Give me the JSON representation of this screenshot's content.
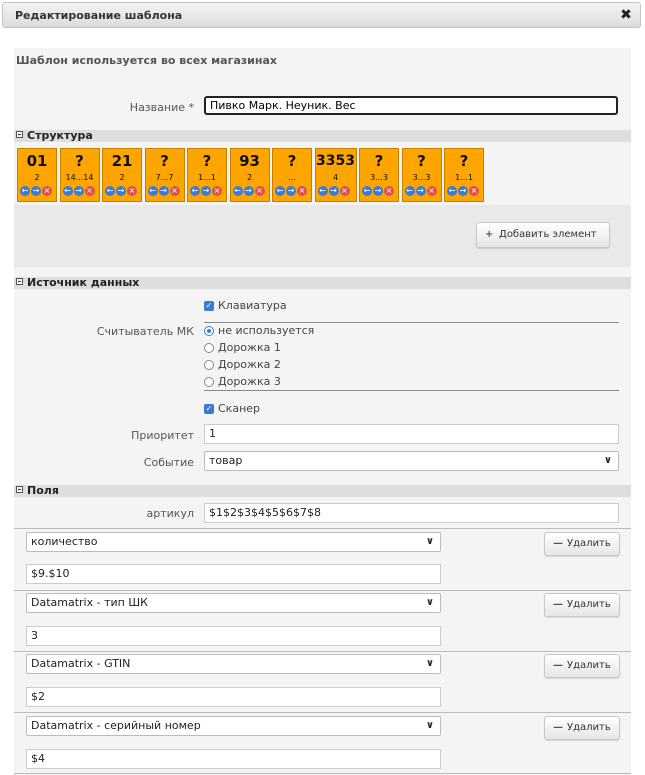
{
  "window": {
    "title": "Редактирование шаблона",
    "close_label": "✖"
  },
  "info_text": "Шаблон используется во всех магазинах",
  "name": {
    "label": "Название *",
    "value": "Пивко Марк. Неуник. Вес"
  },
  "structure": {
    "header": "Структура",
    "blocks": [
      {
        "big": "01",
        "small": "2"
      },
      {
        "big": "?",
        "small": "14...14"
      },
      {
        "big": "21",
        "small": "2"
      },
      {
        "big": "?",
        "small": "7...7"
      },
      {
        "big": "?",
        "small": "1...1"
      },
      {
        "big": "93",
        "small": "2"
      },
      {
        "big": "?",
        "small": "..."
      },
      {
        "big": "3353",
        "small": "4"
      },
      {
        "big": "?",
        "small": "3...3"
      },
      {
        "big": "?",
        "small": "3...3"
      },
      {
        "big": "?",
        "small": "1...1"
      }
    ],
    "add_button": "Добавить элемент"
  },
  "data_source": {
    "header": "Источник данных",
    "keyboard_label": "Клавиатура",
    "reader_label": "Считыватель МК",
    "reader_options": [
      "не используется",
      "Дорожка 1",
      "Дорожка 2",
      "Дорожка 3"
    ],
    "scanner_label": "Сканер",
    "priority_label": "Приоритет",
    "priority_value": "1",
    "event_label": "Событие",
    "event_value": "товар"
  },
  "fields": {
    "header": "Поля",
    "article_label": "артикул",
    "article_value": "$1$2$3$4$5$6$7$8",
    "delete_label": "Удалить",
    "rows": [
      {
        "select": "количество",
        "value": "$9.$10"
      },
      {
        "select": "Datamatrix - тип ШК",
        "value": "3"
      },
      {
        "select": "Datamatrix - GTIN",
        "value": "$2"
      },
      {
        "select": "Datamatrix - серийный номер",
        "value": "$4"
      }
    ]
  },
  "colors": {
    "block": "#ffa500",
    "accent": "#3a7bd5",
    "delete": "#d9534f"
  }
}
